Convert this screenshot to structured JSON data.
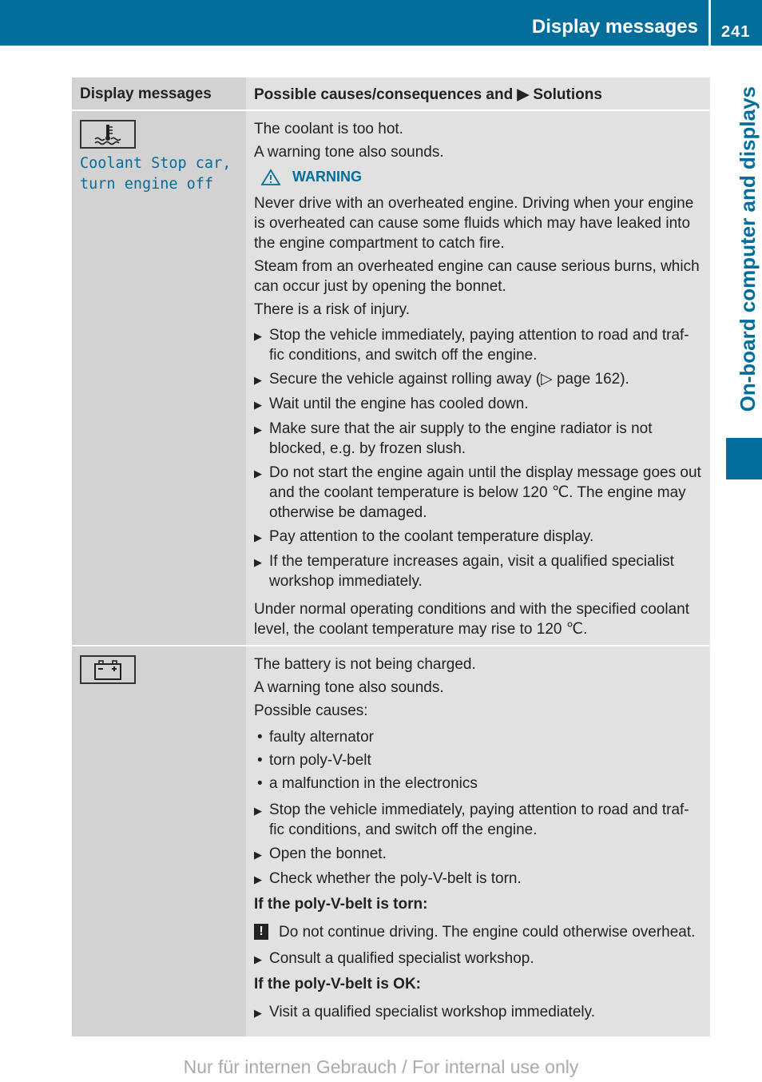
{
  "header": {
    "section_title": "Display messages",
    "page_number": "241"
  },
  "side_tab": {
    "label": "On-board computer and displays"
  },
  "table": {
    "columns": [
      "Display messages",
      "Possible causes/consequences and ▶ Solutions"
    ],
    "rows": [
      {
        "icon": "coolant-temperature-icon",
        "message": "Coolant Stop car,\nturn engine off",
        "intro": [
          "The coolant is too hot.",
          "A warning tone also sounds."
        ],
        "warning_label": "WARNING",
        "warning_text": [
          "Never drive with an overheated engine. Driving when your engine is overheated can cause some fluids which may have leaked into the engine compartment to catch fire.",
          "Steam from an overheated engine can cause serious burns, which can occur just by opening the bonnet.",
          "There is a risk of injury."
        ],
        "actions": [
          "Stop the vehicle immediately, paying attention to road and traf-fic conditions, and switch off the engine.",
          "Secure the vehicle against rolling away (▷ page 162).",
          "Wait until the engine has cooled down.",
          "Make sure that the air supply to the engine radiator is not blocked, e.g. by frozen slush.",
          "Do not start the engine again until the display message goes out and the coolant temperature is below 120 ℃. The engine may otherwise be damaged.",
          "Pay attention to the coolant temperature display.",
          "If the temperature increases again, visit a qualified specialist workshop immediately."
        ],
        "outro": "Under normal operating conditions and with the specified coolant level, the coolant temperature may rise to 120 ℃."
      },
      {
        "icon": "battery-icon",
        "intro": [
          "The battery is not being charged.",
          "A warning tone also sounds.",
          "Possible causes:"
        ],
        "causes": [
          "faulty alternator",
          "torn poly-V-belt",
          "a malfunction in the electronics"
        ],
        "actions": [
          "Stop the vehicle immediately, paying attention to road and traf-fic conditions, and switch off the engine.",
          "Open the bonnet.",
          "Check whether the poly-V-belt is torn."
        ],
        "if_torn_heading": "If the poly-V-belt is torn:",
        "if_torn_note": "Do not continue driving. The engine could otherwise overheat.",
        "if_torn_action": "Consult a qualified specialist workshop.",
        "if_ok_heading": "If the poly-V-belt is OK:",
        "if_ok_action": "Visit a qualified specialist workshop immediately."
      }
    ]
  },
  "footer": {
    "watermark": "Nur für internen Gebrauch / For internal use only"
  },
  "colors": {
    "brand_blue": "#036d9c",
    "col1_bg": "#d2d2d2",
    "col2_bg": "#e1e1e1"
  }
}
